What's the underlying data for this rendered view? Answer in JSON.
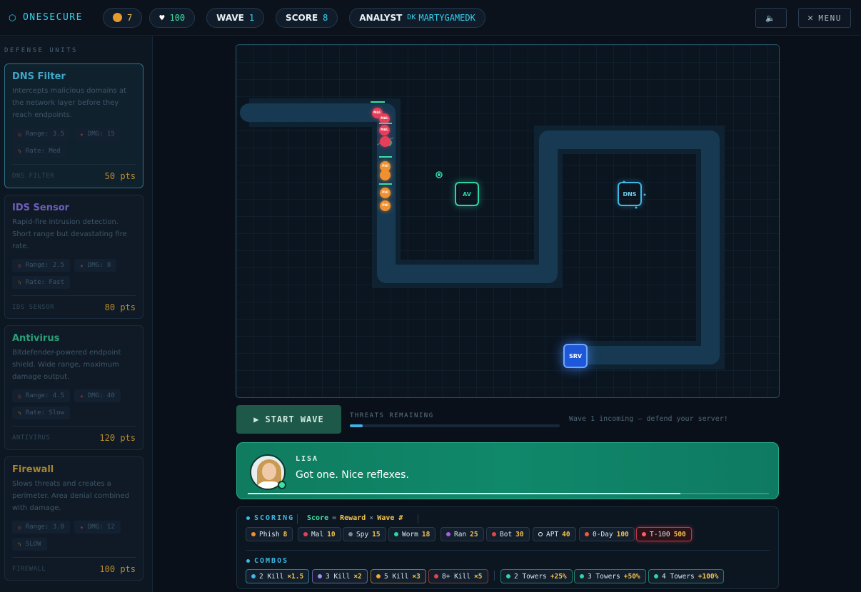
{
  "header": {
    "brand": "ONESECURE",
    "coins": "7",
    "health": "100",
    "wave_label": "WAVE",
    "wave_value": "1",
    "score_label": "SCORE",
    "score_value": "8",
    "analyst_label": "ANALYST",
    "analyst_flag": "DK",
    "analyst_name": "MARTYGAMEDK",
    "sound_icon": "speaker-icon",
    "menu_label": "MENU"
  },
  "sidebar": {
    "title": "DEFENSE UNITS",
    "units": [
      {
        "name": "DNS Filter",
        "color": "#3fa6c8",
        "desc": "Intercepts malicious domains at the network layer before they reach endpoints.",
        "range": "Range: 3.5",
        "dmg": "DMG: 15",
        "rate": "Rate: Med",
        "code": "DNS FILTER",
        "cost": "50 pts"
      },
      {
        "name": "IDS Sensor",
        "color": "#6f5fb8",
        "desc": "Rapid-fire intrusion detection. Short range but devastating fire rate.",
        "range": "Range: 2.5",
        "dmg": "DMG: 8",
        "rate": "Rate: Fast",
        "code": "IDS SENSOR",
        "cost": "80 pts"
      },
      {
        "name": "Antivirus",
        "color": "#2a9f78",
        "desc": "Bitdefender-powered endpoint shield. Wide range, maximum damage output.",
        "range": "Range: 4.5",
        "dmg": "DMG: 40",
        "rate": "Rate: Slow",
        "code": "ANTIVIRUS",
        "cost": "120 pts"
      },
      {
        "name": "Firewall",
        "color": "#a8842e",
        "desc": "Slows threats and creates a perimeter. Area denial combined with damage.",
        "range": "Range: 3.0",
        "dmg": "DMG: 12",
        "rate": "SLOW",
        "code": "FIREWALL",
        "cost": "100 pts"
      }
    ]
  },
  "map": {
    "towers": {
      "av": "AV",
      "dns": "DNS",
      "srv": "SRV"
    },
    "enemies": [
      "MAL",
      "MAL",
      "MAL",
      "PHI",
      "PHI",
      "PHI"
    ]
  },
  "wave": {
    "start_label": "START WAVE",
    "threats_label": "THREATS REMAINING",
    "threats_progress": 0.06,
    "message": "Wave 1 incoming — defend your server!"
  },
  "dialog": {
    "speaker": "LISA",
    "line": "Got one. Nice reflexes.",
    "progress": 0.83
  },
  "scoring": {
    "title": "SCORING",
    "formula_score": "Score",
    "formula_eq": "=",
    "formula_reward": "Reward",
    "formula_times": "×",
    "formula_wave": "Wave #",
    "threats": [
      {
        "name": "Phish",
        "pts": "8",
        "color": "#f0902f"
      },
      {
        "name": "Mal",
        "pts": "10",
        "color": "#e73f5a"
      },
      {
        "name": "Spy",
        "pts": "15",
        "color": "#7a8a98"
      },
      {
        "name": "Worm",
        "pts": "18",
        "color": "#2fd6a2"
      },
      {
        "name": "Ran",
        "pts": "25",
        "color": "#a760e8"
      },
      {
        "name": "Bot",
        "pts": "30",
        "color": "#e04848"
      },
      {
        "name": "APT",
        "pts": "40",
        "color": "#ffffff"
      },
      {
        "name": "0-Day",
        "pts": "100",
        "color": "#f05a3a"
      },
      {
        "name": "T-100",
        "pts": "500",
        "color": "#ff5a6a"
      }
    ],
    "combos_title": "COMBOS",
    "combos": [
      {
        "name": "2 Kill",
        "bonus": "×1.5",
        "color": "#3fb8e6"
      },
      {
        "name": "3 Kill",
        "bonus": "×2",
        "color": "#a78bfa"
      },
      {
        "name": "5 Kill",
        "bonus": "×3",
        "color": "#f2a33a"
      },
      {
        "name": "8+ Kill",
        "bonus": "×5",
        "color": "#e04848"
      }
    ],
    "tower_combos": [
      {
        "name": "2 Towers",
        "bonus": "+25%",
        "color": "#2fd6a2"
      },
      {
        "name": "3 Towers",
        "bonus": "+50%",
        "color": "#2fd6a2"
      },
      {
        "name": "4 Towers",
        "bonus": "+100%",
        "color": "#2fd6a2"
      }
    ]
  }
}
